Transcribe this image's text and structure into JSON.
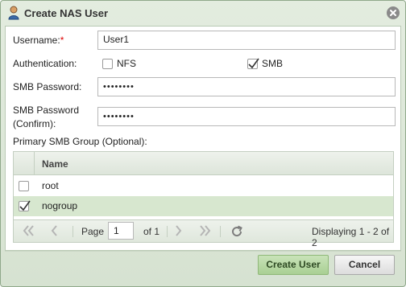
{
  "dialog": {
    "title": "Create NAS User",
    "title_icon": "user-icon",
    "close_icon": "close-icon"
  },
  "form": {
    "username_label": "Username:",
    "username_required_mark": "*",
    "username_value": "User1",
    "auth_label": "Authentication:",
    "auth_nfs_label": "NFS",
    "auth_nfs_checked": false,
    "auth_smb_label": "SMB",
    "auth_smb_checked": true,
    "smb_password_label": "SMB Password:",
    "smb_password_value": "••••••••",
    "smb_password_confirm_label_line1": "SMB Password",
    "smb_password_confirm_label_line2": "(Confirm):",
    "smb_password_confirm_value": "••••••••",
    "group_section_label": "Primary SMB Group (Optional):"
  },
  "grid": {
    "column_header": "Name",
    "rows": [
      {
        "name": "root",
        "checked": false,
        "selected": false
      },
      {
        "name": "nogroup",
        "checked": true,
        "selected": true
      }
    ]
  },
  "pager": {
    "page_label": "Page",
    "page_value": "1",
    "of_label": "of 1",
    "displaying": "Displaying 1 - 2 of 2",
    "icons": [
      "first-page-icon",
      "prev-page-icon",
      "next-page-icon",
      "last-page-icon",
      "refresh-icon"
    ]
  },
  "footer": {
    "create_label": "Create User",
    "cancel_label": "Cancel"
  },
  "colors": {
    "accent": "#a9cf93",
    "selected_row": "#d7e7cf",
    "required": "#dd0000"
  }
}
